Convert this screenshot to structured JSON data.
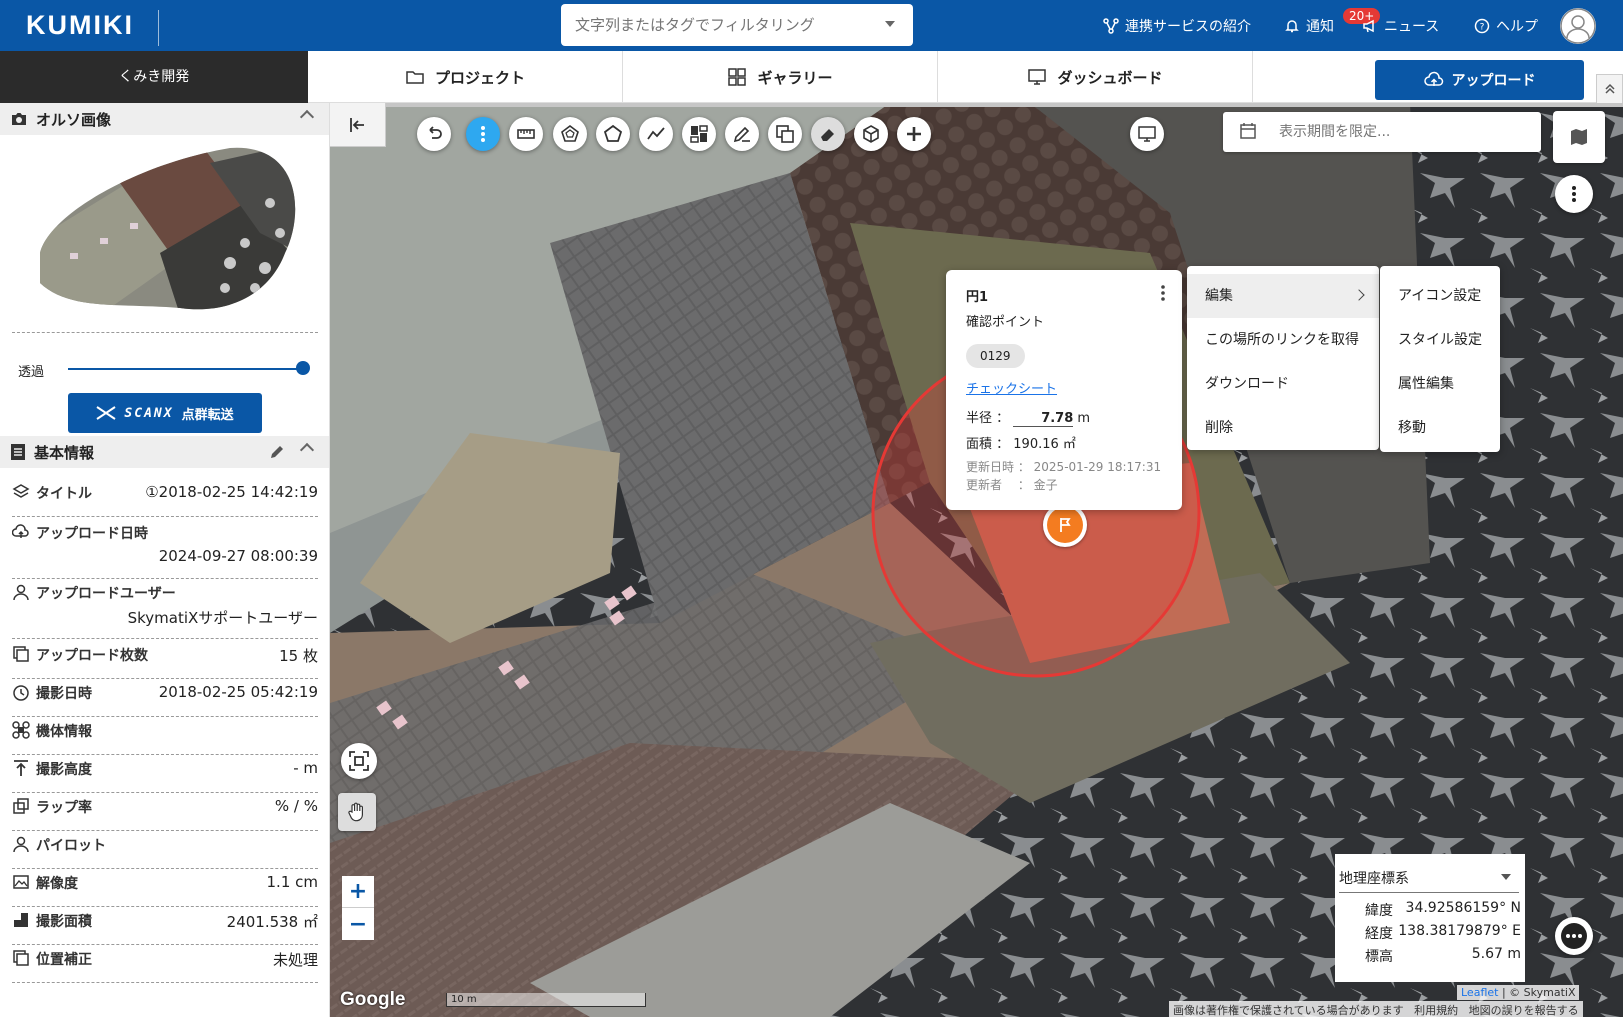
{
  "header": {
    "logo": "KUMIKI",
    "search_placeholder": "文字列またはタグでフィルタリング",
    "services": "連携サービスの紹介",
    "notifications": "通知",
    "notification_badge": "20+",
    "news": "ニュース",
    "help": "ヘルプ"
  },
  "nav": {
    "side_title": "くみき開発",
    "tabs": [
      "プロジェクト",
      "ギャラリー",
      "ダッシュボード"
    ],
    "upload": "アップロード"
  },
  "panel": {
    "ortho_title": "オルソ画像",
    "transparency_label": "透過",
    "transparency_value": 1.0,
    "scanx_logo": "SCANX",
    "scanx_suffix": "点群転送",
    "basic_title": "基本情報",
    "rows": [
      {
        "label": "タイトル",
        "value": "①2018-02-25 14:42:19",
        "icon": "layers-icon"
      },
      {
        "label": "アップロード日時",
        "value": "2024-09-27 08:00:39",
        "icon": "cloud-upload-icon"
      },
      {
        "label": "アップロードユーザー",
        "value": "SkymatiXサポートユーザー",
        "icon": "user-icon"
      },
      {
        "label": "アップロード枚数",
        "value": "15 枚",
        "icon": "images-icon"
      },
      {
        "label": "撮影日時",
        "value": "2018-02-25 05:42:19",
        "icon": "clock-icon"
      },
      {
        "label": "機体情報",
        "value": "",
        "icon": "drone-icon"
      },
      {
        "label": "撮影高度",
        "value": "- m",
        "icon": "altitude-icon"
      },
      {
        "label": "ラップ率",
        "value": "% / %",
        "icon": "overlap-icon"
      },
      {
        "label": "パイロット",
        "value": "",
        "icon": "pilot-icon"
      },
      {
        "label": "解像度",
        "value": "1.1 cm",
        "icon": "resolution-icon"
      },
      {
        "label": "撮影面積",
        "value": "2401.538 ㎡",
        "icon": "area-icon"
      },
      {
        "label": "位置補正",
        "value": "未処理",
        "icon": "correction-icon"
      }
    ]
  },
  "map": {
    "date_placeholder": "表示期間を限定...",
    "popup": {
      "title": "円1",
      "subtitle": "確認ポイント",
      "tag": "0129",
      "link": "チェックシート",
      "radius_label": "半径 ：",
      "radius_value": "7.78",
      "radius_unit": "m",
      "area_label": "面積 ：",
      "area_value": "190.16 ㎡",
      "updated_label": "更新日時 ：",
      "updated_value": "2025-01-29 18:17:31",
      "updater_label": "更新者 　：",
      "updater_value": "金子"
    },
    "menu": [
      "編集",
      "この場所のリンクを取得",
      "ダウンロード",
      "削除"
    ],
    "submenu": [
      "アイコン設定",
      "スタイル設定",
      "属性編集",
      "移動"
    ],
    "coords": {
      "system": "地理座標系",
      "lat_label": "緯度",
      "lat_value": "34.92586159° N",
      "lon_label": "経度",
      "lon_value": "138.38179879° E",
      "alt_label": "標高",
      "alt_value": "5.67 m"
    },
    "scale": "10 m",
    "google": "Google",
    "attribution_leaflet": "Leaflet",
    "attribution_rest": "| © SkymatiX",
    "footer_copyright": "画像は著作権で保護されている場合があります",
    "footer_terms": "利用規約",
    "footer_report": "地図の誤りを報告する"
  },
  "colors": {
    "brand": "#0a57a6",
    "active_tool": "#2ea8f0",
    "circle": "#e53935"
  }
}
